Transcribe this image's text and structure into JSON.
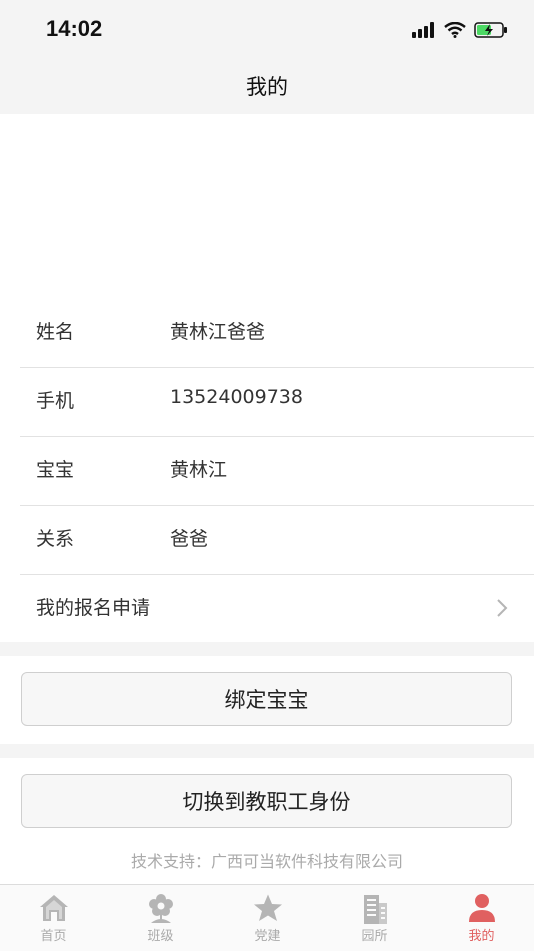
{
  "status_bar": {
    "time": "14:02"
  },
  "nav": {
    "title": "我的"
  },
  "profile": {
    "rows": [
      {
        "label": "姓名",
        "value": "黄林江爸爸"
      },
      {
        "label": "手机",
        "value": "13524009738"
      },
      {
        "label": "宝宝",
        "value": "黄林江"
      },
      {
        "label": "关系",
        "value": "爸爸"
      }
    ],
    "signup_link": "我的报名申请"
  },
  "buttons": {
    "bind_baby": "绑定宝宝",
    "switch_role": "切换到教职工身份"
  },
  "footer": {
    "support": "技术支持：广西可当软件科技有限公司"
  },
  "tabs": [
    {
      "label": "首页",
      "icon": "home-icon"
    },
    {
      "label": "班级",
      "icon": "flower-icon"
    },
    {
      "label": "党建",
      "icon": "star-icon"
    },
    {
      "label": "园所",
      "icon": "building-icon"
    },
    {
      "label": "我的",
      "icon": "person-icon",
      "active": true
    }
  ],
  "colors": {
    "accent": "#e06060",
    "inactive": "#aaaaaa",
    "background": "#f4f4f4"
  }
}
